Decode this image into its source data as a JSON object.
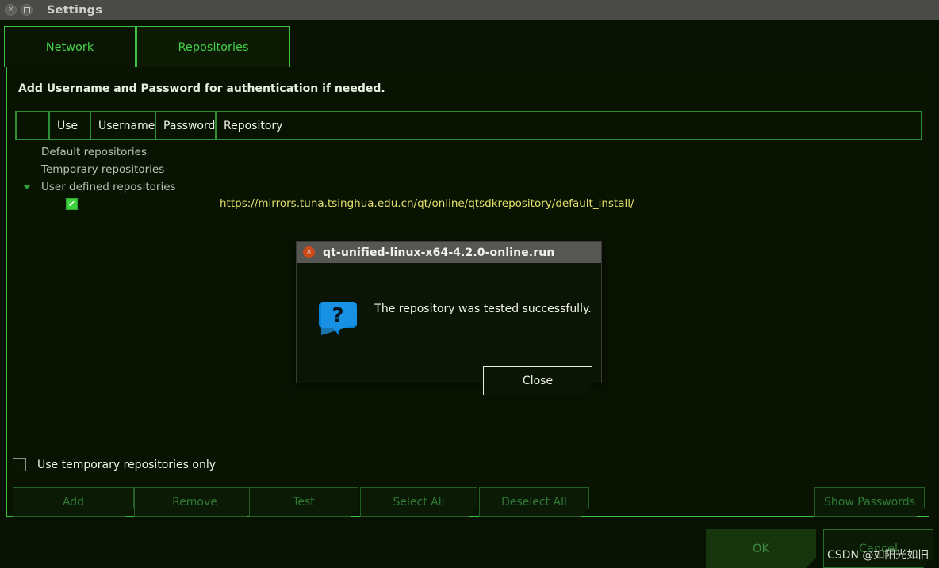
{
  "window": {
    "title": "Settings",
    "controls": [
      {
        "name": "close-icon",
        "glyph": "×"
      },
      {
        "name": "maximize-icon",
        "glyph": ""
      }
    ]
  },
  "tabs": [
    {
      "label": "Network",
      "active": false
    },
    {
      "label": "Repositories",
      "active": true
    }
  ],
  "panel": {
    "hint": "Add Username and Password for authentication if needed.",
    "table": {
      "columns": [
        "",
        "Use",
        "Username",
        "Password",
        "Repository"
      ],
      "tree": [
        {
          "label": "Default repositories",
          "level": 0,
          "expanded": false
        },
        {
          "label": "Temporary repositories",
          "level": 0,
          "expanded": false
        },
        {
          "label": "User defined repositories",
          "level": 0,
          "expanded": true
        }
      ],
      "rows": [
        {
          "checked": true,
          "check_glyph": "✔",
          "username": "",
          "password": "",
          "repository": "https://mirrors.tuna.tsinghua.edu.cn/qt/online/qtsdkrepository/default_install/"
        }
      ]
    },
    "use_temp_only": {
      "label": "Use temporary repositories only",
      "checked": false
    },
    "buttons": [
      {
        "label": "Add",
        "enabled": false
      },
      {
        "label": "Remove",
        "enabled": false
      },
      {
        "label": "Test",
        "enabled": false
      },
      {
        "label": "Select All",
        "enabled": false
      },
      {
        "label": "Deselect All",
        "enabled": false
      },
      {
        "label": "Show Passwords",
        "enabled": false
      }
    ]
  },
  "footer": {
    "ok_label": "OK",
    "cancel_label": "Cancel"
  },
  "dialog": {
    "title": "qt-unified-linux-x64-4.2.0-online.run",
    "close_glyph": "×",
    "icon": "question-speech-bubble-icon",
    "message": "The repository was tested successfully.",
    "button_label": "Close"
  },
  "watermark": "CSDN @如阳光如旧",
  "colors": {
    "accent_green": "#3fc03f",
    "tab_text": "#44d24a",
    "url_yellow": "#e3e06a",
    "background": "#081202",
    "titlebar": "#4a4a48",
    "dialog_titlebar": "#565654",
    "dialog_close": "#cc4a18",
    "checkbox_checked": "#3bd13b",
    "icon_blue": "#0a84d8"
  }
}
